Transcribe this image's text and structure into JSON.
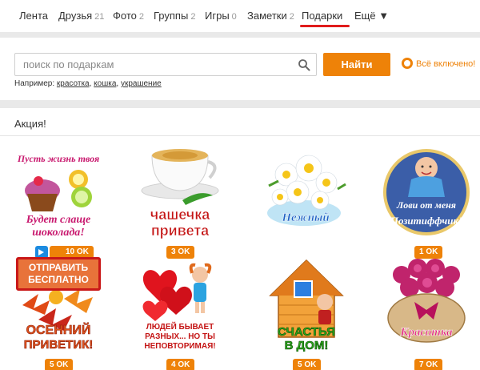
{
  "nav": {
    "items": [
      {
        "label": "Лента",
        "count": ""
      },
      {
        "label": "Друзья",
        "count": "21"
      },
      {
        "label": "Фото",
        "count": "2"
      },
      {
        "label": "Группы",
        "count": "2"
      },
      {
        "label": "Игры",
        "count": "0"
      },
      {
        "label": "Заметки",
        "count": "2"
      },
      {
        "label": "Подарки",
        "count": ""
      },
      {
        "label": "Ещё ▼",
        "count": ""
      }
    ],
    "active": "Подарки",
    "accent_color": "#e01c1c"
  },
  "search": {
    "placeholder": "поиск по подаркам",
    "value": "",
    "button_label": "Найти",
    "all_included": "Всё включено!",
    "examples_prefix": "Например:",
    "examples": [
      "красотка",
      "кошка",
      "украшение"
    ]
  },
  "section": {
    "title": "Акция!",
    "free_badge": "ОТПРАВИТЬ БЕСПЛАТНО"
  },
  "gifts": [
    {
      "caption": "Пусть жизнь твоя будет слаще шоколада!",
      "price": "10 OK",
      "video": true,
      "icon": "cupcake-icon"
    },
    {
      "caption": "чашечка привета",
      "price": "3 OK",
      "video": false,
      "icon": "tea-cup-icon"
    },
    {
      "caption": "Нежный",
      "price": "",
      "video": false,
      "icon": "daisies-icon"
    },
    {
      "caption": "Лови от меня позитиффчик!",
      "price": "1 OK",
      "video": false,
      "icon": "baby-icon"
    },
    {
      "caption": "Осенний приветик!",
      "price": "5 OK",
      "video": false,
      "icon": "autumn-leaves-icon"
    },
    {
      "caption": "Людей бывает разных... но ты неповторимая!",
      "price": "4 OK",
      "video": false,
      "icon": "hearts-girl-icon"
    },
    {
      "caption": "Счастья в дом!",
      "price": "5 OK",
      "video": false,
      "icon": "house-icon"
    },
    {
      "caption": "Красотка",
      "price": "7 OK",
      "video": false,
      "icon": "roses-icon"
    }
  ],
  "colors": {
    "brand_orange": "#ee8208",
    "video_blue": "#1c8be0"
  }
}
